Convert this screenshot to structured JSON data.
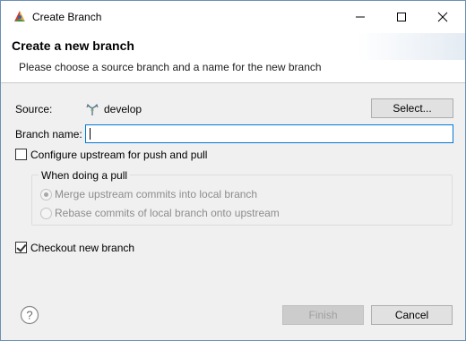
{
  "window": {
    "title": "Create Branch",
    "controls": {
      "minimize": "minimize-icon",
      "maximize": "maximize-icon",
      "close": "close-icon"
    }
  },
  "header": {
    "title": "Create a new branch",
    "description": "Please choose a source branch and a name for the new branch"
  },
  "source": {
    "label": "Source:",
    "icon": "branch-icon",
    "value": "develop",
    "select_label": "Select..."
  },
  "branch_name": {
    "label": "Branch name:",
    "value": "",
    "placeholder": ""
  },
  "configure_upstream": {
    "label": "Configure upstream for push and pull",
    "checked": false
  },
  "pull_group": {
    "title": "When doing a pull",
    "options": [
      {
        "label": "Merge upstream commits into local branch",
        "selected": true,
        "enabled": false
      },
      {
        "label": "Rebase commits of local branch onto upstream",
        "selected": false,
        "enabled": false
      }
    ]
  },
  "checkout": {
    "label": "Checkout new branch",
    "checked": true
  },
  "footer": {
    "help_icon": "help-icon",
    "finish_label": "Finish",
    "finish_enabled": false,
    "cancel_label": "Cancel"
  },
  "colors": {
    "focus_border": "#0078d7",
    "dialog_bg": "#f0f0f0",
    "disabled_text": "#8d8d8d"
  }
}
